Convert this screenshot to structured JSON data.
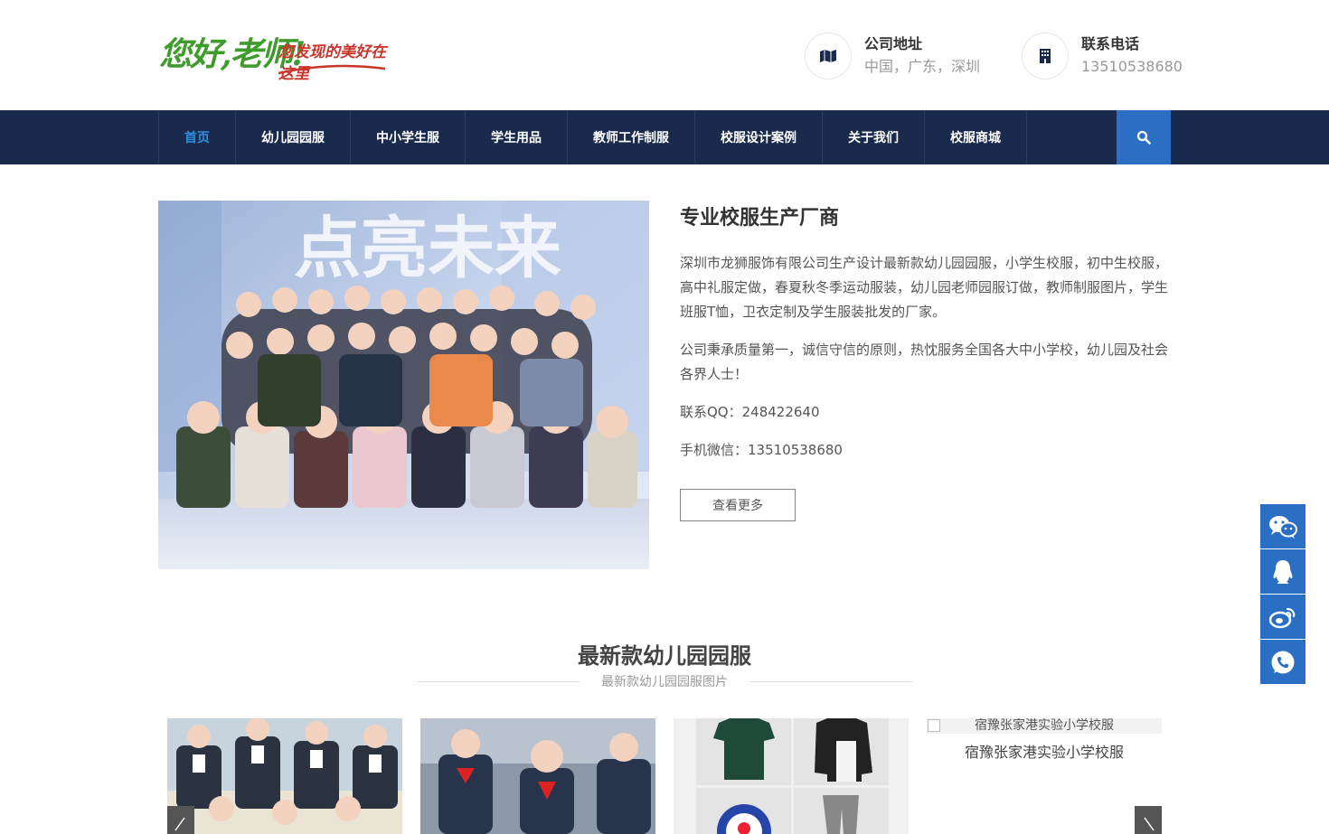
{
  "header": {
    "logo": {
      "main_text": "您好,老师!",
      "tagline": "您发现的美好在这里"
    },
    "address": {
      "title": "公司地址",
      "value": "中国，广东，深圳",
      "icon": "map-icon"
    },
    "phone": {
      "title": "联系电话",
      "value": "13510538680",
      "icon": "building-icon"
    }
  },
  "nav": {
    "items": [
      {
        "label": "首页",
        "active": true
      },
      {
        "label": "幼儿园园服"
      },
      {
        "label": "中小学生服"
      },
      {
        "label": "学生用品"
      },
      {
        "label": "教师工作制服"
      },
      {
        "label": "校服设计案例"
      },
      {
        "label": "关于我们"
      },
      {
        "label": "校服商城"
      }
    ],
    "search_icon": "search-icon"
  },
  "intro": {
    "image_text": "点亮未来",
    "title": "专业校服生产厂商",
    "paragraph1": "深圳市龙狮服饰有限公司生产设计最新款幼儿园园服，小学生校服，初中生校服，高中礼服定做，春夏秋冬季运动服装，幼儿园老师园服订做，教师制服图片，学生班服T恤，卫衣定制及学生服装批发的厂家。",
    "paragraph2": "公司秉承质量第一，诚信守信的原则，热忱服务全国各大中小学校，幼儿园及社会各界人士！",
    "qq": "联系QQ：248422640",
    "wechat": "手机微信：13510538680",
    "more_button": "查看更多"
  },
  "section": {
    "title": "最新款幼儿园园服",
    "subtitle": "最新款幼儿园园服图片"
  },
  "products": [
    {
      "caption": ""
    },
    {
      "caption": ""
    },
    {
      "caption": ""
    },
    {
      "alt": "宿豫张家港实验小学校服",
      "caption": "宿豫张家港实验小学校服"
    }
  ],
  "sidebar": {
    "icons": [
      "wechat-icon",
      "qq-icon",
      "weibo-icon",
      "phone-icon"
    ]
  },
  "colors": {
    "nav_bg": "#1a2a4c",
    "accent": "#2a6fc4",
    "active_nav": "#2c8fe0",
    "logo_green": "#3f9b2c",
    "logo_red": "#c8352b"
  }
}
